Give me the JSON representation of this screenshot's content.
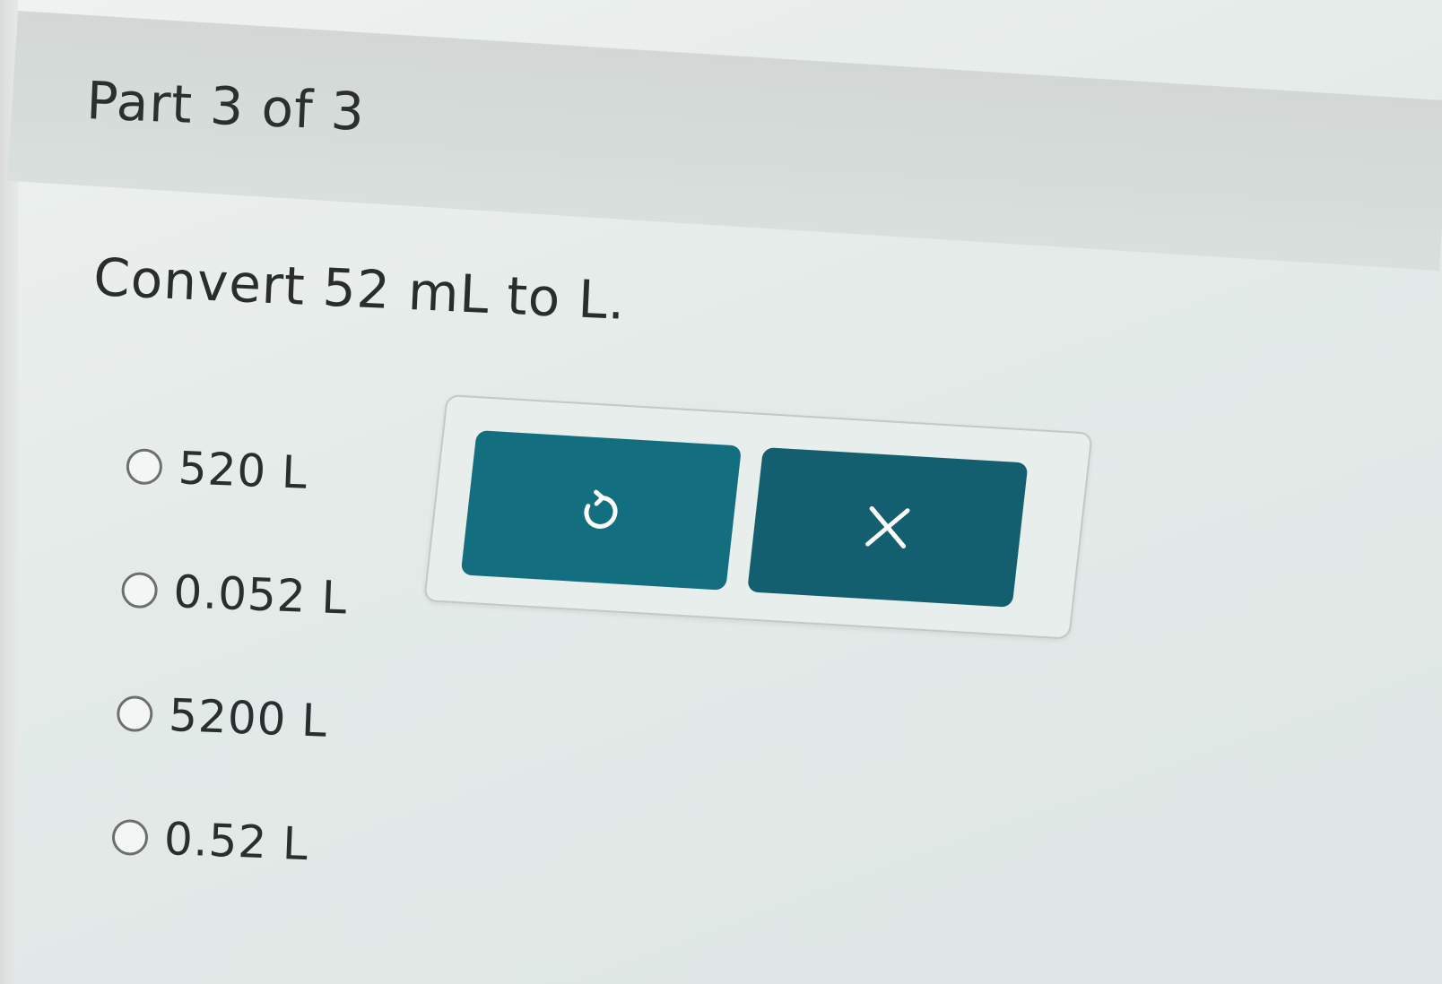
{
  "header": {
    "part_label": "Part 3 of 3"
  },
  "question": {
    "prompt": "Convert 52 mL to L."
  },
  "options": [
    {
      "label": "520 L",
      "selected": false
    },
    {
      "label": "0.052 L",
      "selected": false
    },
    {
      "label": "5200 L",
      "selected": false
    },
    {
      "label": "0.52 L",
      "selected": false
    }
  ],
  "actions": {
    "reset_icon": "undo-icon",
    "clear_icon": "close-icon",
    "button_color": "#136f7f"
  }
}
